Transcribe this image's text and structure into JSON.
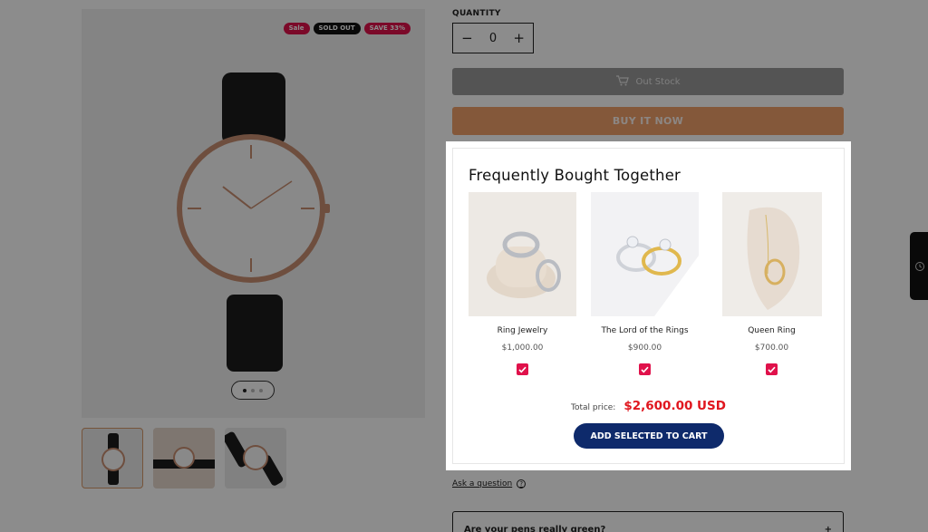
{
  "product": {
    "badges": {
      "sale": "Sale",
      "sold_out": "SOLD OUT",
      "save": "SAVE 33%"
    },
    "quantity_label": "QUANTITY",
    "quantity_value": "0",
    "out_stock_label": "Out Stock",
    "buy_now_label": "BUY IT NOW",
    "ask_question_label": "Ask a question",
    "faq_question": "Are your pens really green?"
  },
  "popup": {
    "title": "Frequently Bought Together",
    "items": [
      {
        "name": "Ring Jewelry",
        "price": "$1,000.00",
        "checked": true
      },
      {
        "name": "The Lord of the Rings",
        "price": "$900.00",
        "checked": true
      },
      {
        "name": "Queen Ring",
        "price": "$700.00",
        "checked": true
      }
    ],
    "total_label": "Total price:",
    "total_value": "$2,600.00 USD",
    "add_button": "ADD SELECTED TO CART"
  },
  "colors": {
    "accent_red": "#e0114b",
    "navy": "#0e2a6b",
    "buy_now": "#f0a06a"
  }
}
